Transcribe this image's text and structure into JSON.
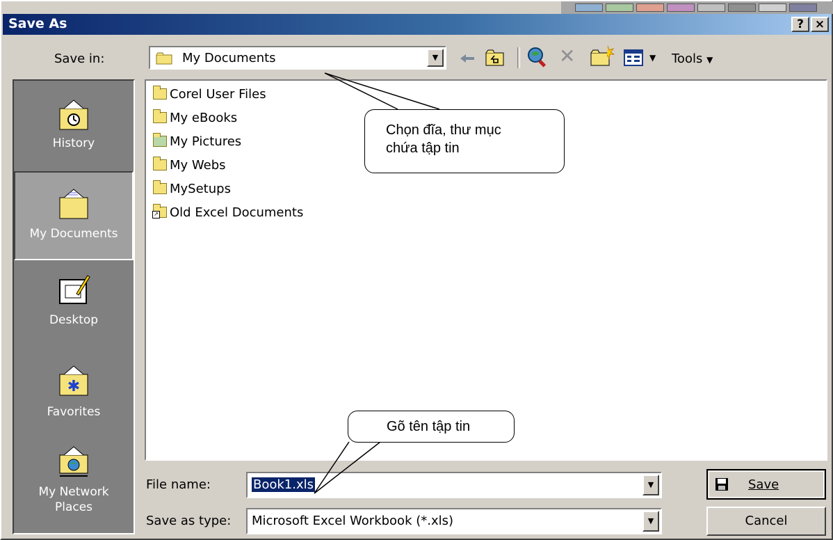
{
  "window": {
    "title": "Save As",
    "help_btn": "?",
    "close_btn": "×"
  },
  "toolbar": {
    "save_in_label": "Save in:",
    "save_in_value": "My Documents",
    "tools_label": "Tools",
    "icons": [
      "back-icon",
      "up-folder-icon",
      "search-web-icon",
      "delete-icon",
      "new-folder-icon",
      "views-icon"
    ]
  },
  "places": [
    {
      "label": "History",
      "icon": "history-icon"
    },
    {
      "label": "My Documents",
      "icon": "my-documents-icon",
      "selected": true
    },
    {
      "label": "Desktop",
      "icon": "desktop-icon"
    },
    {
      "label": "Favorites",
      "icon": "favorites-icon"
    },
    {
      "label": "My Network Places",
      "icon": "network-places-icon"
    }
  ],
  "files": [
    {
      "name": "Corel User Files",
      "icon": "folder-icon"
    },
    {
      "name": "My eBooks",
      "icon": "folder-icon"
    },
    {
      "name": "My Pictures",
      "icon": "pictures-folder-icon"
    },
    {
      "name": "My Webs",
      "icon": "folder-icon"
    },
    {
      "name": "MySetups",
      "icon": "folder-icon"
    },
    {
      "name": "Old Excel Documents",
      "icon": "folder-shortcut-icon"
    }
  ],
  "form": {
    "file_name_label": "File name:",
    "file_name_value": "Book1.xls",
    "save_type_label": "Save as type:",
    "save_type_value": "Microsoft Excel Workbook (*.xls)",
    "save_button": "Save",
    "cancel_button": "Cancel"
  },
  "callouts": {
    "folder_line1": "Chọn đĩa, thư mục",
    "folder_line2": "chứa tập tin",
    "filename": "Gõ tên tập tin"
  },
  "colors": {
    "title_start": "#0a246a",
    "title_end": "#a6caf0",
    "face": "#d4d0c8",
    "places_bg": "#808080",
    "selection": "#0a246a"
  }
}
